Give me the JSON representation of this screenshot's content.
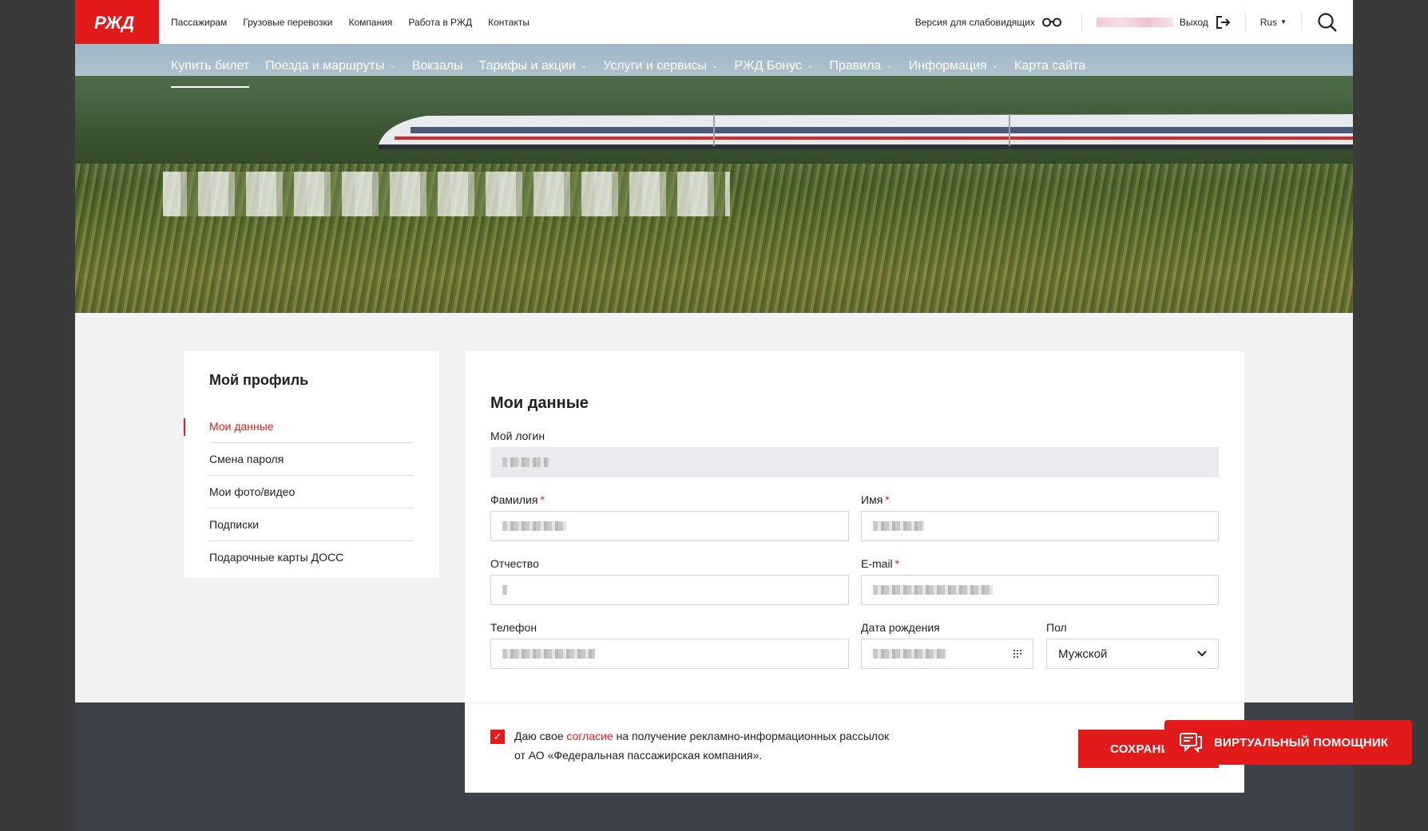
{
  "brand": {
    "logo_text": "РЖД",
    "accent": "#e21a1a"
  },
  "topbar": {
    "links": [
      "Пассажирам",
      "Грузовые перевозки",
      "Компания",
      "Работа в РЖД",
      "Контакты"
    ],
    "vision_label": "Версия для слабовидящих",
    "logout_label": "Выход",
    "lang_label": "Rus"
  },
  "mainnav": [
    {
      "label": "Купить билет",
      "dropdown": false
    },
    {
      "label": "Поезда и маршруты",
      "dropdown": true
    },
    {
      "label": "Вокзалы",
      "dropdown": false
    },
    {
      "label": "Тарифы и акции",
      "dropdown": true
    },
    {
      "label": "Услуги и сервисы",
      "dropdown": true
    },
    {
      "label": "РЖД Бонус",
      "dropdown": true
    },
    {
      "label": "Правила",
      "dropdown": true
    },
    {
      "label": "Информация",
      "dropdown": true
    },
    {
      "label": "Карта сайта",
      "dropdown": false
    }
  ],
  "sidebar": {
    "title": "Мой профиль",
    "items": [
      "Мои данные",
      "Смена пароля",
      "Мои фото/видео",
      "Подписки",
      "Подарочные карты ДОСС"
    ],
    "active_index": 0
  },
  "form": {
    "title": "Мои данные",
    "login_label": "Мой логин",
    "lastname_label": "Фамилия",
    "firstname_label": "Имя",
    "middlename_label": "Отчество",
    "email_label": "E-mail",
    "phone_label": "Телефон",
    "birthdate_label": "Дата рождения",
    "gender_label": "Пол",
    "gender_value": "Мужской",
    "consent_pre": "Даю свое",
    "consent_link": "согласие",
    "consent_post": "на получение рекламно-информационных рассылок",
    "consent_line2": "от АО «Федеральная пассажирская компания».",
    "save_label": "СОХРАНИТЬ"
  },
  "assistant": {
    "label": "ВИРТУАЛЬНЫЙ ПОМОЩНИК"
  }
}
